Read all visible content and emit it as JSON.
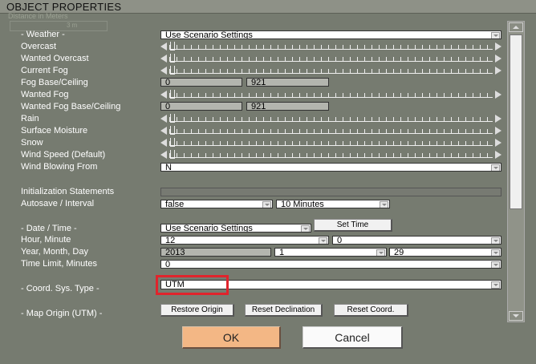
{
  "window": {
    "title": "OBJECT PROPERTIES"
  },
  "faded_header": {
    "text": "Distance in Meters",
    "value": "3 m"
  },
  "colors": {
    "accent_ok": "#f3b785",
    "highlight_border": "#e0242c"
  },
  "weather": {
    "section_label": "- Weather -",
    "mode_value": "Use Scenario Settings",
    "overcast_label": "Overcast",
    "wanted_overcast_label": "Wanted Overcast",
    "current_fog_label": "Current Fog",
    "fog_base_label": "Fog Base/Ceiling",
    "fog_base_value": "0",
    "fog_ceiling_value": "921",
    "wanted_fog_label": "Wanted Fog",
    "wanted_fog_base_label": "Wanted Fog Base/Ceiling",
    "wanted_fog_base_value": "0",
    "wanted_fog_ceiling_value": "921",
    "rain_label": "Rain",
    "surface_moisture_label": "Surface Moisture",
    "snow_label": "Snow",
    "wind_speed_label": "Wind Speed (Default)",
    "wind_from_label": "Wind Blowing From",
    "wind_from_value": "N"
  },
  "init": {
    "statements_label": "Initialization Statements",
    "statements_value": "",
    "autosave_label": "Autosave / Interval",
    "autosave_value": "false",
    "interval_value": "10 Minutes"
  },
  "datetime": {
    "section_label": "- Date / Time -",
    "mode_value": "Use Scenario Settings",
    "set_time_label": "Set Time",
    "hour_minute_label": "Hour, Minute",
    "hour_value": "12",
    "minute_value": "0",
    "ymd_label": "Year, Month, Day",
    "year_value": "2013",
    "month_value": "1",
    "day_value": "29",
    "time_limit_label": "Time Limit, Minutes",
    "time_limit_value": "0"
  },
  "coord": {
    "type_label": "- Coord. Sys. Type -",
    "type_value": "UTM",
    "map_origin_label": "- Map Origin (UTM) -",
    "restore_origin_label": "Restore Origin",
    "reset_declination_label": "Reset Declination",
    "reset_coord_label": "Reset Coord."
  },
  "footer": {
    "ok_label": "OK",
    "cancel_label": "Cancel"
  }
}
